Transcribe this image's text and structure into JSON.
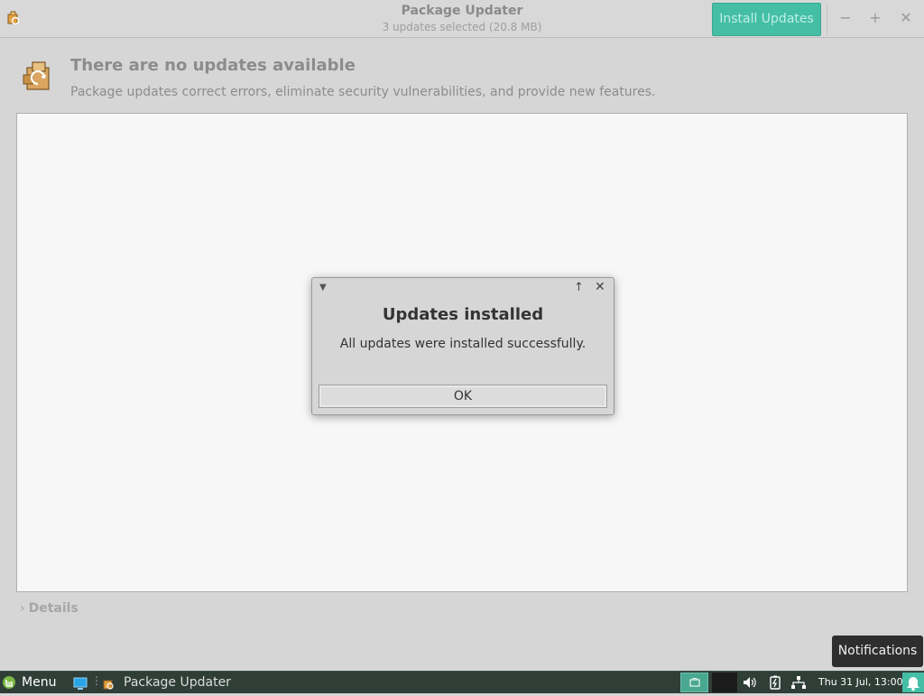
{
  "window": {
    "title": "Package Updater",
    "subtitle": "3 updates selected (20.8 MB)",
    "install_button": "Install Updates",
    "controls": {
      "minimize": "−",
      "maximize": "+",
      "close": "✕"
    }
  },
  "info": {
    "title": "There are no updates available",
    "description": "Package updates correct errors, eliminate security vulnerabilities, and provide new features."
  },
  "details": {
    "label": "Details"
  },
  "dialog": {
    "title": "Updates installed",
    "message": "All updates were installed successfully.",
    "ok_button": "OK"
  },
  "notification_tooltip": "Notifications",
  "taskbar": {
    "menu_label": "Menu",
    "window_label": "Package Updater",
    "clock": "Thu 31 Jul, 13:00"
  },
  "colors": {
    "accent": "#44bfa6",
    "taskbar": "#2f3e37",
    "menu_leaf": "#7ab846"
  }
}
